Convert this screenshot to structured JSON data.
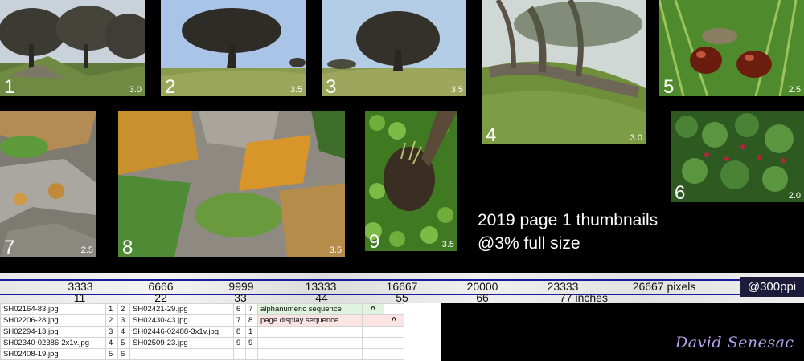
{
  "thumbnails": [
    {
      "number": "1",
      "rating": "3.0",
      "icon": "tree-grove-photo"
    },
    {
      "number": "2",
      "rating": "3.5",
      "icon": "oak-tree-photo"
    },
    {
      "number": "3",
      "rating": "3.5",
      "icon": "oak-tree-photo"
    },
    {
      "number": "4",
      "rating": "3.0",
      "icon": "twisted-oak-photo"
    },
    {
      "number": "5",
      "rating": "2.5",
      "icon": "acorns-photo"
    },
    {
      "number": "6",
      "rating": "2.0",
      "icon": "berry-shrub-photo"
    },
    {
      "number": "7",
      "rating": "2.5",
      "icon": "lichen-rock-photo"
    },
    {
      "number": "8",
      "rating": "3.5",
      "icon": "lichen-rock-photo"
    },
    {
      "number": "9",
      "rating": "3.5",
      "icon": "clover-stump-photo"
    }
  ],
  "caption": {
    "line1": "2019 page 1 thumbnails",
    "line2": "@3% full size"
  },
  "ruler": {
    "pixels": [
      "3333",
      "6666",
      "9999",
      "13333",
      "16667",
      "20000",
      "23333",
      "26667 pixels"
    ],
    "inches": [
      "11",
      "22",
      "33",
      "44",
      "55",
      "66",
      "77 inches"
    ],
    "ppi": "@300ppi",
    "line_color": "#1a1aa0"
  },
  "sheet": {
    "rows": [
      [
        "SH02164-83.jpg",
        "1",
        "2",
        "SH02421-29.jpg",
        "6",
        "7",
        "alphanumeric sequence",
        "^",
        ""
      ],
      [
        "SH02206-28.jpg",
        "2",
        "3",
        "SH02430-43.jpg",
        "7",
        "8",
        "page display sequence",
        "",
        "^"
      ],
      [
        "SH02294-13.jpg",
        "3",
        "4",
        "SH02446-02488-3x1v.jpg",
        "8",
        "1",
        "",
        "",
        ""
      ],
      [
        "SH02340-02386-2x1v.jpg",
        "4",
        "5",
        "SH02509-23.jpg",
        "9",
        "9",
        "",
        "",
        ""
      ],
      [
        "SH02408-19.jpg",
        "5",
        "6",
        "",
        "",
        "",
        "",
        "",
        ""
      ]
    ]
  },
  "signature": "David Senesac"
}
